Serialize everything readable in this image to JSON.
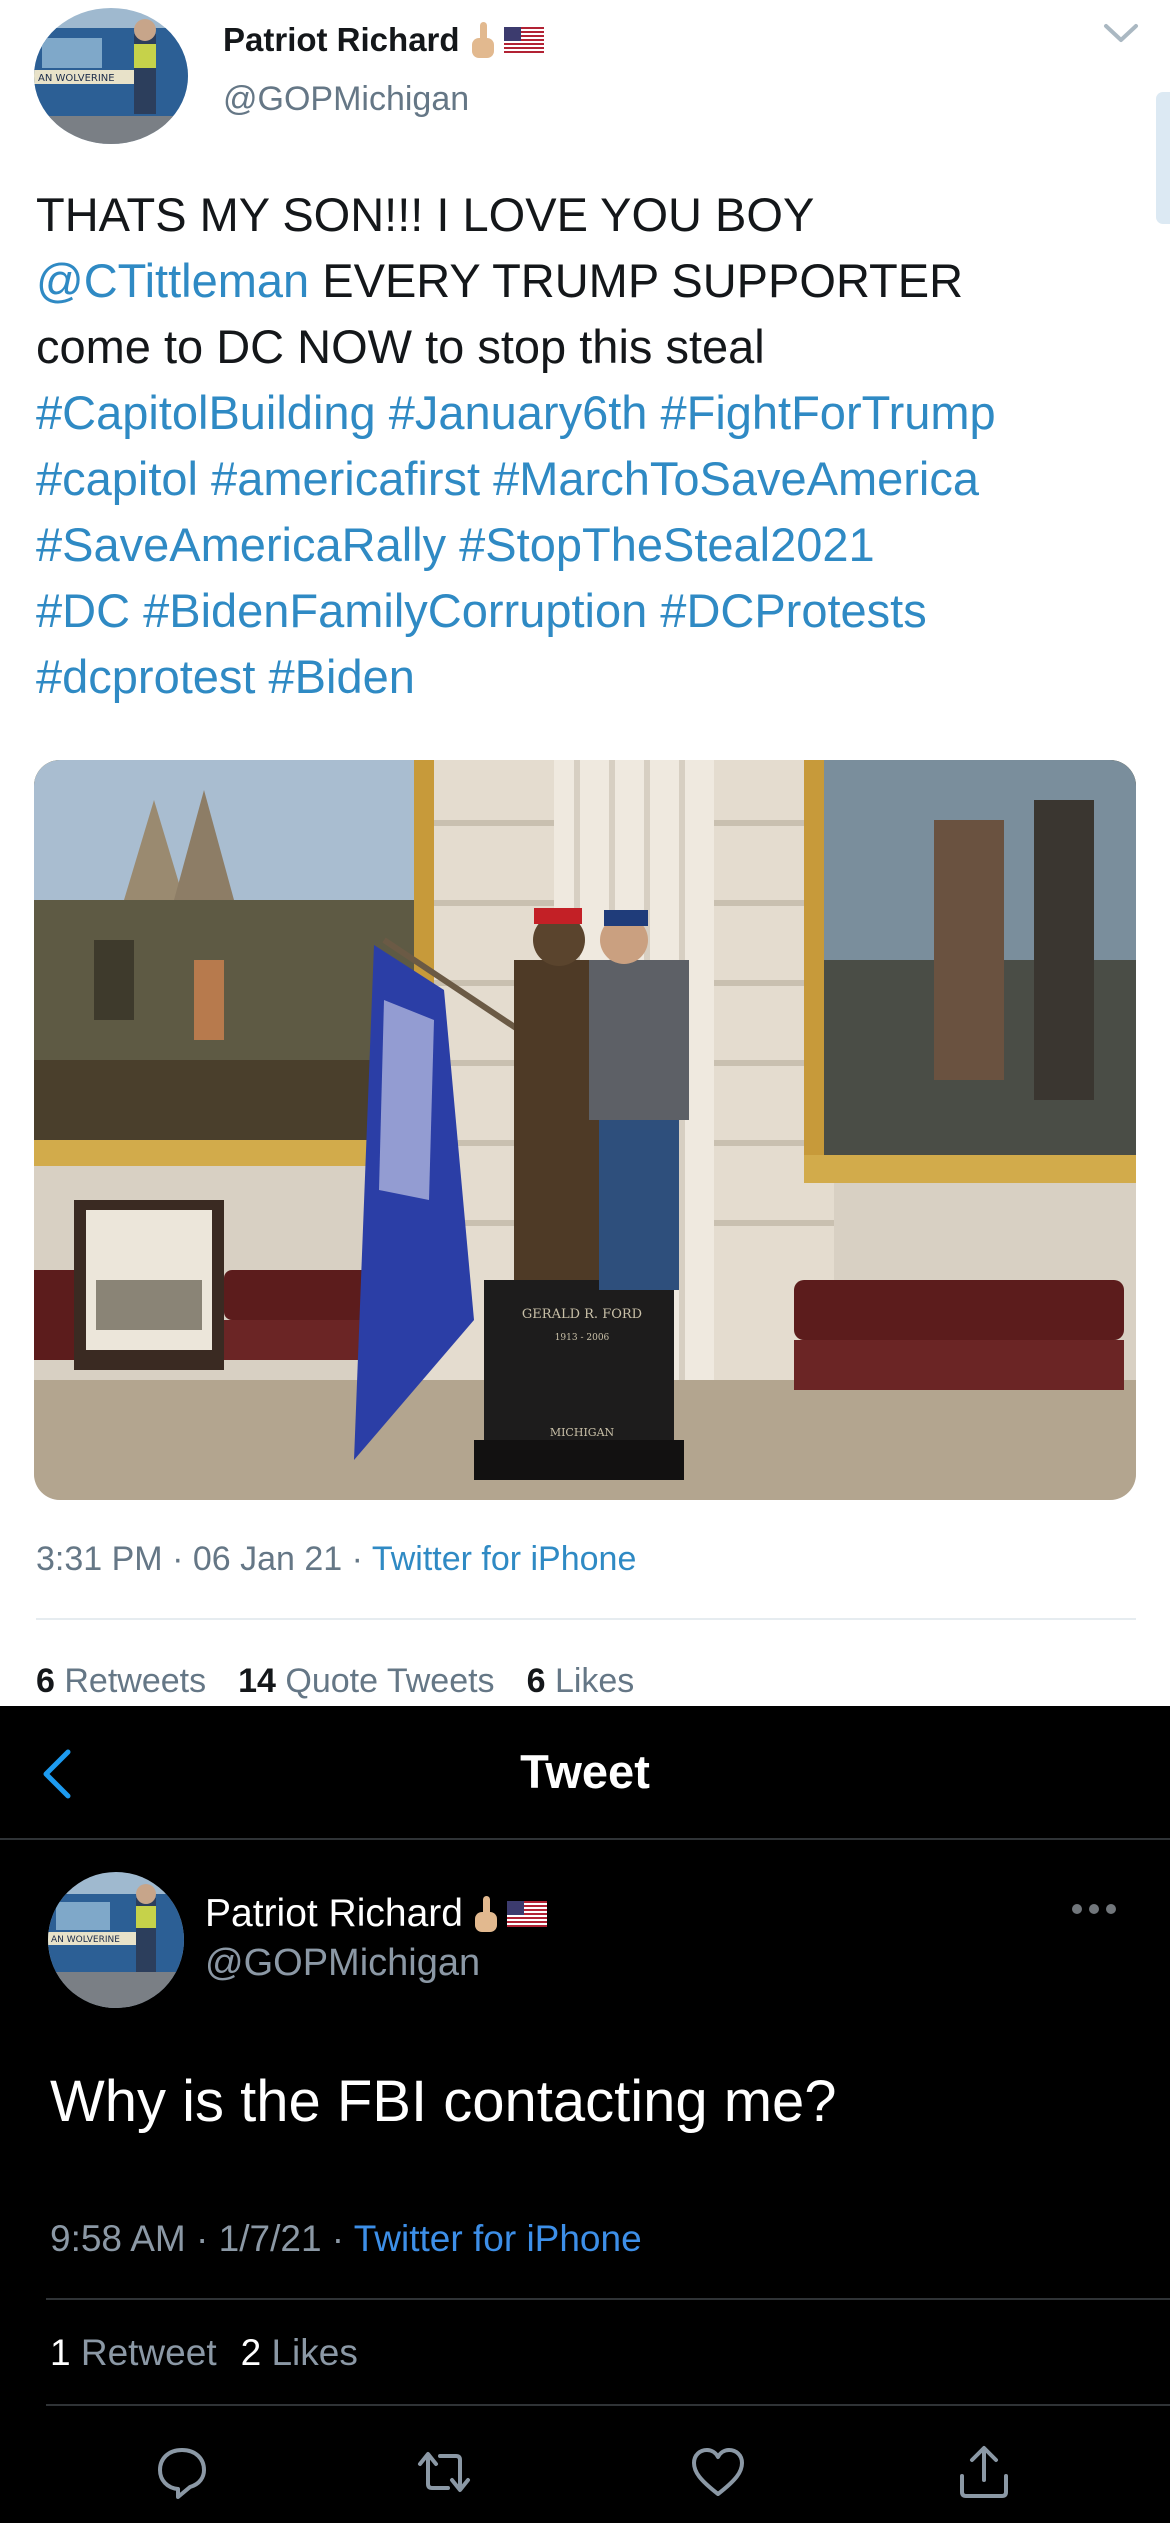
{
  "light_tweet": {
    "author_name": "Patriot Richard",
    "author_handle": "@GOPMichigan",
    "text_lines": [
      [
        {
          "t": "THATS MY SON!!! I LOVE YOU BOY",
          "link": false
        }
      ],
      [
        {
          "t": "@CTittleman",
          "link": true
        },
        {
          "t": " EVERY TRUMP SUPPORTER",
          "link": false
        }
      ],
      [
        {
          "t": "come to DC NOW to stop this steal",
          "link": false
        }
      ],
      [
        {
          "t": "#CapitolBuilding #January6th #FightForTrump",
          "link": true
        }
      ],
      [
        {
          "t": "#capitol #americafirst #MarchToSaveAmerica",
          "link": true
        }
      ],
      [
        {
          "t": "#SaveAmericaRally #StopTheSteal2021",
          "link": true
        }
      ],
      [
        {
          "t": "#DC #BidenFamilyCorruption #DCProtests",
          "link": true
        }
      ],
      [
        {
          "t": "#dcprotest #Biden",
          "link": true
        }
      ]
    ],
    "time": "3:31 PM",
    "date": "06 Jan 21",
    "source": "Twitter for iPhone",
    "sep": " · ",
    "retweets_count": "6",
    "retweets_label": "Retweets",
    "quotes_count": "14",
    "quotes_label": "Quote Tweets",
    "likes_count": "6",
    "likes_label": "Likes",
    "photo_plaque_lines": [
      "GERALD R. FORD",
      "1913 - 2006",
      "MICHIGAN"
    ]
  },
  "dark_tweet": {
    "header_title": "Tweet",
    "author_name": "Patriot Richard",
    "author_handle": "@GOPMichigan",
    "text": "Why is the FBI contacting me?",
    "time": "9:58 AM",
    "date": "1/7/21",
    "source": "Twitter for iPhone",
    "sep": " · ",
    "retweets_count": "1",
    "retweets_label": "Retweet",
    "likes_count": "2",
    "likes_label": "Likes"
  },
  "icons": {
    "light_header": [
      "middle-finger-emoji-icon",
      "us-flag-icon",
      "chevron-down-icon"
    ],
    "dark_header": [
      "back-arrow-icon",
      "middle-finger-emoji-icon",
      "us-flag-icon",
      "more-options-icon"
    ],
    "actions": [
      "reply-icon",
      "retweet-icon",
      "like-icon",
      "share-icon"
    ]
  },
  "colors": {
    "link_light": "#2f8ac4",
    "link_dark": "#3d8fe8",
    "secondary_light": "#657786",
    "secondary_dark": "#8b98a5",
    "dark_bg": "#000000"
  }
}
